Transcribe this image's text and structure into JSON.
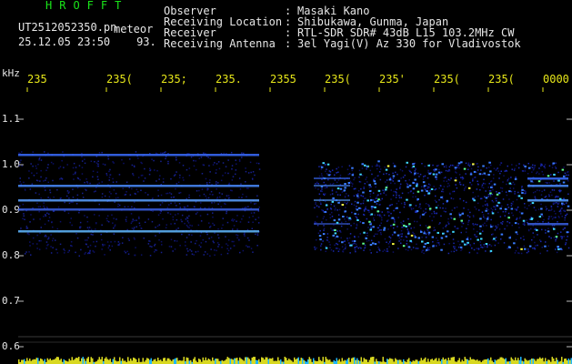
{
  "header": {
    "app_title": "HROFFT",
    "file_name": "UT2512052350.pn",
    "file_suffix": "meteor",
    "datetime": "25.12.05 23:50",
    "datetime_extra": "93."
  },
  "observer": {
    "labels": [
      "Observer",
      "Receiving Location",
      "Receiver",
      "Receiving Antenna"
    ],
    "values": [
      "Masaki Kano",
      "Shibukawa, Gunma, Japan",
      "RTL-SDR SDR# 43dB L15 103.2MHz CW",
      "3el Yagi(V) Az 330 for Vladivostok"
    ]
  },
  "axis": {
    "unit": "kHz",
    "x_ticks": [
      "235",
      "235(",
      "235;",
      "235.",
      "2355",
      "235(",
      "235'",
      "235(",
      "235(",
      "0000"
    ],
    "y_ticks": [
      "1.1",
      "1.0",
      "0.9",
      "0.8",
      "0.7",
      "0.6"
    ]
  },
  "colors": {
    "green_text": "#19e619",
    "yellow_ticks": "#e6e619",
    "signal_blue": "#1e2ecc",
    "signal_peak": "#ffff30"
  }
}
